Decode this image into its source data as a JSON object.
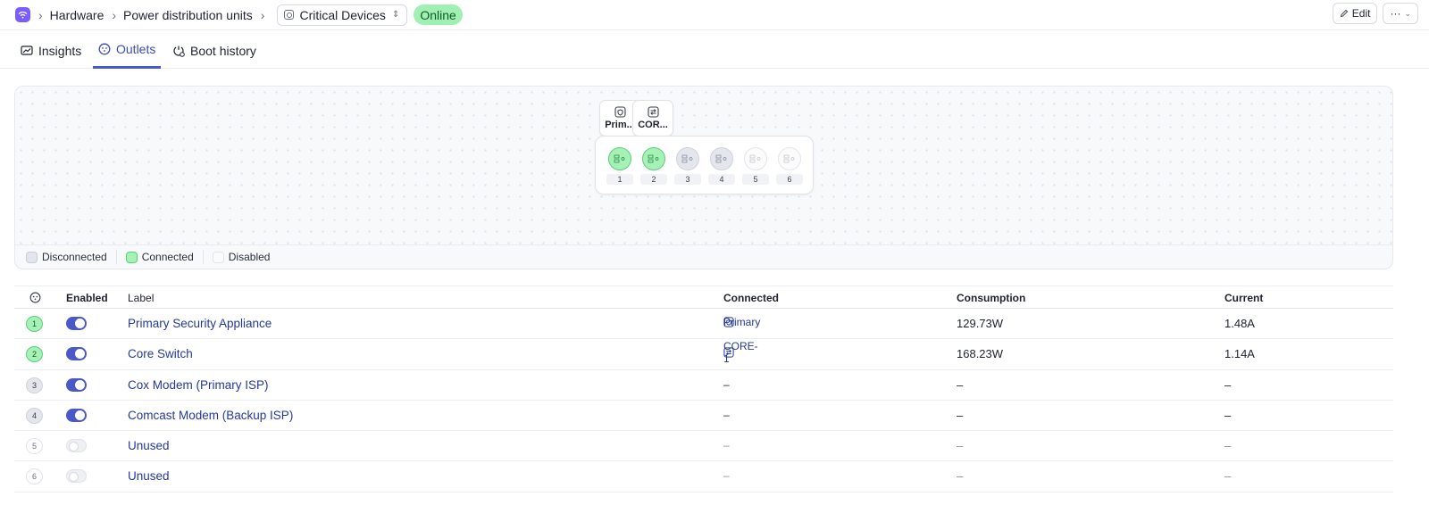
{
  "breadcrumb": {
    "items": [
      "Hardware",
      "Power distribution units"
    ],
    "device": "Critical Devices",
    "status": "Online"
  },
  "actions": {
    "edit": "Edit",
    "more": "···"
  },
  "tabs": [
    {
      "label": "Insights",
      "icon": "insights-icon"
    },
    {
      "label": "Outlets",
      "icon": "outlet-icon",
      "active": true
    },
    {
      "label": "Boot history",
      "icon": "boot-history-icon"
    }
  ],
  "diagram": {
    "devices": [
      {
        "label": "Prim...",
        "icon": "security-appliance-icon",
        "outlet": 1
      },
      {
        "label": "COR...",
        "icon": "switch-icon",
        "outlet": 2
      }
    ],
    "outlets": [
      {
        "num": "1",
        "state": "connected"
      },
      {
        "num": "2",
        "state": "connected"
      },
      {
        "num": "3",
        "state": "disconnected"
      },
      {
        "num": "4",
        "state": "disconnected"
      },
      {
        "num": "5",
        "state": "disabled"
      },
      {
        "num": "6",
        "state": "disabled"
      }
    ],
    "legend": [
      "Disconnected",
      "Connected",
      "Disabled"
    ]
  },
  "table": {
    "headers": {
      "enabled": "Enabled",
      "label": "Label",
      "connected": "Connected",
      "consumption": "Consumption",
      "current": "Current"
    },
    "rows": [
      {
        "num": "1",
        "state": "connected",
        "enabled": true,
        "label": "Primary Security Appliance",
        "connected": "Primary",
        "connected_icon": "security-appliance-icon",
        "consumption": "129.73W",
        "current": "1.48A"
      },
      {
        "num": "2",
        "state": "connected",
        "enabled": true,
        "label": "Core Switch",
        "connected": "CORE-1",
        "connected_icon": "switch-icon",
        "consumption": "168.23W",
        "current": "1.14A"
      },
      {
        "num": "3",
        "state": "disconnected",
        "enabled": true,
        "label": "Cox Modem (Primary ISP)",
        "connected": "–",
        "consumption": "–",
        "current": "–"
      },
      {
        "num": "4",
        "state": "disconnected",
        "enabled": true,
        "label": "Comcast Modem (Backup ISP)",
        "connected": "–",
        "consumption": "–",
        "current": "–"
      },
      {
        "num": "5",
        "state": "disabled",
        "enabled": false,
        "label": "Unused",
        "connected": "–",
        "consumption": "–",
        "current": "–"
      },
      {
        "num": "6",
        "state": "disabled",
        "enabled": false,
        "label": "Unused",
        "connected": "–",
        "consumption": "–",
        "current": "–"
      }
    ]
  },
  "colors": {
    "accent": "#4a58c8",
    "connected": "#a6f2b6",
    "disconnected": "#e4e6ed",
    "online": "#9ff0b2"
  }
}
